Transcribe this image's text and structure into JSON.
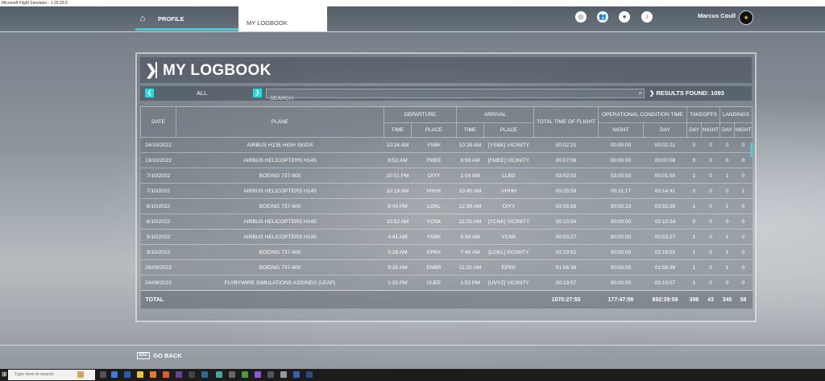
{
  "window_title": "Microsoft Flight Simulator - 1.29.29.0",
  "nav": {
    "profile_label": "PROFILE",
    "logbook_label": "MY LOGBOOK",
    "username": "Marcus Coull"
  },
  "logbook": {
    "title": "MY LOGBOOK",
    "filter_value": "ALL",
    "search_placeholder": "SEARCH",
    "results_label": "RESULTS FOUND: 1093"
  },
  "table": {
    "headers": {
      "date": "DATE",
      "plane": "PLANE",
      "departure": "DEPARTURE",
      "arrival": "ARRIVAL",
      "total_time": "TOTAL TIME OF FLIGHT",
      "operational": "OPERATIONAL CONDITION TIME",
      "takeoffs": "TAKEOFFS",
      "landings": "LANDINGS",
      "time": "TIME",
      "place": "PLACE",
      "night": "NIGHT",
      "day": "DAY",
      "day_short": "DAY",
      "night_short": "NIGHT"
    },
    "rows": [
      {
        "date": "24/10/2022",
        "plane": "AIRBUS H135 HIGH SKIDS",
        "dep_time": "10:24 AM",
        "dep_place": "YSBK",
        "arr_time": "10:26 AM",
        "arr_place": "[YSBK] VICINITY",
        "total": "00:02:21",
        "night": "00:00:00",
        "day": "00:02:21",
        "to_day": "0",
        "to_night": "0",
        "ld_day": "0",
        "ld_night": "0"
      },
      {
        "date": "13/10/2022",
        "plane": "AIRBUS HELICOPTERS H145",
        "dep_time": "8:52 AM",
        "dep_place": "FMEE",
        "arr_time": "8:59 AM",
        "arr_place": "[FMEE] VICINITY",
        "total": "00:07:08",
        "night": "00:00:00",
        "day": "00:07:08",
        "to_day": "0",
        "to_night": "0",
        "ld_day": "0",
        "ld_night": "0"
      },
      {
        "date": "7/10/2022",
        "plane": "BOEING 737-600",
        "dep_time": "10:01 PM",
        "dep_place": "OIYY",
        "arr_time": "1:04 AM",
        "arr_place": "LLBG",
        "total": "03:02:03",
        "night": "03:00:53",
        "day": "00:01:50",
        "to_day": "1",
        "to_night": "0",
        "ld_day": "1",
        "ld_night": "0"
      },
      {
        "date": "7/10/2022",
        "plane": "AIRBUS HELICOPTERS H145",
        "dep_time": "10:19 AM",
        "dep_place": "VHHX",
        "arr_time": "10:45 AM",
        "arr_place": "VHHH",
        "total": "00:25:58",
        "night": "00:11:17",
        "day": "00:14:41",
        "to_day": "0",
        "to_night": "0",
        "ld_day": "0",
        "ld_night": "1"
      },
      {
        "date": "6/10/2022",
        "plane": "BOEING 737-600",
        "dep_time": "8:43 PM",
        "dep_place": "LGKL",
        "arr_time": "12:39 AM",
        "arr_place": "OIYY",
        "total": "03:55:58",
        "night": "00:00:23",
        "day": "03:55:35",
        "to_day": "1",
        "to_night": "0",
        "ld_day": "1",
        "ld_night": "0"
      },
      {
        "date": "6/10/2022",
        "plane": "AIRBUS HELICOPTERS H145",
        "dep_time": "10:52 AM",
        "dep_place": "YCNK",
        "arr_time": "11:03 AM",
        "arr_place": "[YCNK] VICINITY",
        "total": "00:10:54",
        "night": "00:00:00",
        "day": "00:10:54",
        "to_day": "0",
        "to_night": "0",
        "ld_day": "0",
        "ld_night": "0"
      },
      {
        "date": "5/10/2022",
        "plane": "AIRBUS HELICOPTERS H145",
        "dep_time": "4:41 AM",
        "dep_place": "YSBK",
        "arr_time": "5:34 AM",
        "arr_place": "YCNK",
        "total": "00:53:27",
        "night": "00:00:00",
        "day": "00:53:27",
        "to_day": "1",
        "to_night": "0",
        "ld_day": "1",
        "ld_night": "0"
      },
      {
        "date": "3/10/2022",
        "plane": "BOEING 737-600",
        "dep_time": "5:28 AM",
        "dep_place": "EPKK",
        "arr_time": "7:48 AM",
        "arr_place": "[LGKL] VICINITY",
        "total": "02:19:52",
        "night": "00:00:00",
        "day": "02:19:52",
        "to_day": "1",
        "to_night": "0",
        "ld_day": "1",
        "ld_night": "0"
      },
      {
        "date": "26/09/2022",
        "plane": "BOEING 737-600",
        "dep_time": "9:25 AM",
        "dep_place": "ENBR",
        "arr_time": "11:22 AM",
        "arr_place": "EPKK",
        "total": "01:56:38",
        "night": "00:00:00",
        "day": "01:56:38",
        "to_day": "1",
        "to_night": "0",
        "ld_day": "1",
        "ld_night": "0"
      },
      {
        "date": "24/09/2022",
        "plane": "FLYBYWIRE SIMULATIONS A320NEO (LEAP)",
        "dep_time": "1:33 PM",
        "dep_place": "UUEE",
        "arr_time": "1:53 PM",
        "arr_place": "[UVYZ] VICINITY",
        "total": "00:19:57",
        "night": "00:00:00",
        "day": "00:19:57",
        "to_day": "1",
        "to_night": "0",
        "ld_day": "0",
        "ld_night": "0"
      }
    ],
    "total": {
      "label": "TOTAL",
      "total": "1070:27:55",
      "night": "177:47:56",
      "day": "892:39:59",
      "to_day": "396",
      "to_night": "43",
      "ld_day": "345",
      "ld_night": "58"
    }
  },
  "footer": {
    "esc_key": "ESC",
    "go_back_label": "GO BACK"
  },
  "taskbar": {
    "search_placeholder": "Type here to search"
  },
  "colors": {
    "accent": "#2fd6da"
  }
}
